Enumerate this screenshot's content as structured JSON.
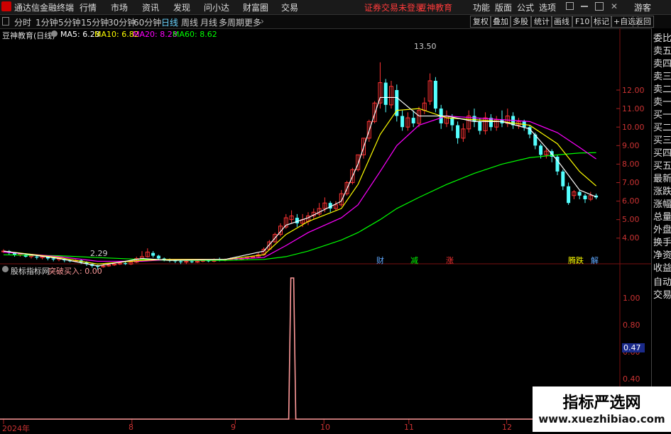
{
  "app": {
    "title": "通达信金融终端"
  },
  "menu": {
    "items": [
      "行情",
      "市场",
      "资讯",
      "发现",
      "问小达",
      "财富圈",
      "交易"
    ],
    "notice": "证券交易未登录",
    "account": "豆神教育",
    "right_items": [
      "功能",
      "版面",
      "公式",
      "选项"
    ],
    "guest": "游客"
  },
  "toolbar": {
    "periods": [
      "分时",
      "1分钟",
      "5分钟",
      "15分钟",
      "30分钟",
      "60分钟",
      "日线",
      "周线",
      "月线",
      "多周期",
      "更多"
    ],
    "selected": "日线",
    "right_buttons": [
      "复权",
      "叠加",
      "多股",
      "统计",
      "画线",
      "F10",
      "标记",
      "+自选",
      "返回"
    ]
  },
  "main_legend": {
    "stock": "豆神教育(日线)",
    "ma": [
      {
        "label": "MA5: 6.23",
        "color": "#ffffff"
      },
      {
        "label": "MA10: 6.82",
        "color": "#ffff00"
      },
      {
        "label": "MA20: 8.28",
        "color": "#ff00ff"
      },
      {
        "label": "MA60: 8.62",
        "color": "#00ff00"
      }
    ]
  },
  "indicator_legend": {
    "name": "股标指标网",
    "value": "突破买入: 0.00"
  },
  "price_axis": [
    "12.00",
    "11.00",
    "10.00",
    "9.00",
    "8.00",
    "7.00",
    "6.00",
    "5.00",
    "4.00"
  ],
  "indicator_axis": [
    "1.00",
    "0.80",
    "0.60",
    "0.40"
  ],
  "indicator_current": "0.47",
  "annotations": {
    "high": "13.50",
    "low": "2.29"
  },
  "event_markers": [
    {
      "label": "财",
      "color": "#5fa8ff"
    },
    {
      "label": "减",
      "color": "#00ff00"
    },
    {
      "label": "涨",
      "color": "#ff3333"
    },
    {
      "label": "腾跌",
      "color": "#ffff00"
    },
    {
      "label": "解",
      "color": "#5fa8ff"
    }
  ],
  "date_axis": [
    "2024年",
    "8",
    "9",
    "10",
    "11",
    "12"
  ],
  "right_panel": [
    "委比",
    "卖五",
    "卖四",
    "卖三",
    "卖二",
    "卖一",
    "买一",
    "买二",
    "买三",
    "买四",
    "买五",
    "最新",
    "涨跌",
    "涨幅",
    "总量",
    "外盘",
    "换手",
    "净资",
    "收益",
    "自动",
    "交易"
  ],
  "watermark": {
    "title": "指标严选网",
    "url": "www.xuezhibiao.com"
  },
  "colors": {
    "up": "#ff3333",
    "down": "#54ffff",
    "ma5": "#ffffff",
    "ma10": "#ffff00",
    "ma20": "#ff00ff",
    "ma60": "#00ff00",
    "signal": "#ff9a9a"
  },
  "chart_data": {
    "type": "candlestick",
    "title": "豆神教育(日线)",
    "ylim": [
      3.0,
      14.0
    ],
    "points": [
      {
        "d": 0,
        "o": 3.3,
        "c": 3.3,
        "h": 3.4,
        "l": 3.2
      },
      {
        "d": 3,
        "o": 3.3,
        "c": 3.2,
        "h": 3.35,
        "l": 3.1
      },
      {
        "d": 6,
        "o": 3.2,
        "c": 3.1,
        "h": 3.25,
        "l": 3.0
      },
      {
        "d": 9,
        "o": 3.1,
        "c": 3.15,
        "h": 3.2,
        "l": 3.0
      },
      {
        "d": 12,
        "o": 3.1,
        "c": 3.0,
        "h": 3.15,
        "l": 2.95
      },
      {
        "d": 15,
        "o": 3.0,
        "c": 3.05,
        "h": 3.1,
        "l": 2.9
      },
      {
        "d": 18,
        "o": 3.0,
        "c": 2.95,
        "h": 3.05,
        "l": 2.85
      },
      {
        "d": 21,
        "o": 2.95,
        "c": 3.0,
        "h": 3.05,
        "l": 2.85
      },
      {
        "d": 24,
        "o": 3.0,
        "c": 2.9,
        "h": 3.05,
        "l": 2.8
      },
      {
        "d": 27,
        "o": 2.9,
        "c": 2.85,
        "h": 2.95,
        "l": 2.75
      },
      {
        "d": 30,
        "o": 2.85,
        "c": 2.9,
        "h": 2.95,
        "l": 2.75
      },
      {
        "d": 33,
        "o": 2.85,
        "c": 2.8,
        "h": 2.9,
        "l": 2.7
      },
      {
        "d": 36,
        "o": 2.8,
        "c": 2.75,
        "h": 2.85,
        "l": 2.7
      },
      {
        "d": 39,
        "o": 2.75,
        "c": 2.8,
        "h": 2.85,
        "l": 2.7
      },
      {
        "d": 42,
        "o": 2.8,
        "c": 2.7,
        "h": 2.85,
        "l": 2.6
      },
      {
        "d": 45,
        "o": 2.7,
        "c": 2.6,
        "h": 2.75,
        "l": 2.5
      },
      {
        "d": 48,
        "o": 2.6,
        "c": 2.5,
        "h": 2.65,
        "l": 2.4
      },
      {
        "d": 51,
        "o": 2.5,
        "c": 2.45,
        "h": 2.55,
        "l": 2.29
      },
      {
        "d": 54,
        "o": 2.45,
        "c": 2.5,
        "h": 2.6,
        "l": 2.4
      },
      {
        "d": 57,
        "o": 2.5,
        "c": 2.55,
        "h": 2.6,
        "l": 2.45
      },
      {
        "d": 60,
        "o": 2.55,
        "c": 2.6,
        "h": 2.65,
        "l": 2.5
      },
      {
        "d": 63,
        "o": 2.6,
        "c": 2.65,
        "h": 2.7,
        "l": 2.55
      },
      {
        "d": 66,
        "o": 2.65,
        "c": 2.6,
        "h": 2.75,
        "l": 2.55
      },
      {
        "d": 69,
        "o": 2.6,
        "c": 2.7,
        "h": 2.8,
        "l": 2.55
      },
      {
        "d": 72,
        "o": 2.7,
        "c": 2.9,
        "h": 3.0,
        "l": 2.65
      },
      {
        "d": 75,
        "o": 2.9,
        "c": 3.0,
        "h": 3.3,
        "l": 2.85
      },
      {
        "d": 78,
        "o": 3.0,
        "c": 3.25,
        "h": 3.45,
        "l": 2.95
      },
      {
        "d": 81,
        "o": 3.2,
        "c": 3.05,
        "h": 3.3,
        "l": 2.95
      },
      {
        "d": 84,
        "o": 3.05,
        "c": 2.9,
        "h": 3.1,
        "l": 2.8
      },
      {
        "d": 87,
        "o": 2.9,
        "c": 2.85,
        "h": 2.95,
        "l": 2.75
      },
      {
        "d": 90,
        "o": 2.85,
        "c": 2.8,
        "h": 2.9,
        "l": 2.7
      },
      {
        "d": 93,
        "o": 2.8,
        "c": 2.75,
        "h": 2.85,
        "l": 2.65
      },
      {
        "d": 96,
        "o": 2.75,
        "c": 2.7,
        "h": 2.8,
        "l": 2.6
      },
      {
        "d": 99,
        "o": 2.7,
        "c": 2.75,
        "h": 2.8,
        "l": 2.6
      },
      {
        "d": 102,
        "o": 2.75,
        "c": 2.7,
        "h": 2.8,
        "l": 2.65
      },
      {
        "d": 105,
        "o": 2.7,
        "c": 2.75,
        "h": 2.85,
        "l": 2.65
      },
      {
        "d": 108,
        "o": 2.75,
        "c": 2.8,
        "h": 2.85,
        "l": 2.7
      },
      {
        "d": 111,
        "o": 2.8,
        "c": 2.75,
        "h": 2.85,
        "l": 2.7
      },
      {
        "d": 114,
        "o": 2.75,
        "c": 2.85,
        "h": 2.9,
        "l": 2.7
      },
      {
        "d": 117,
        "o": 2.85,
        "c": 2.8,
        "h": 2.95,
        "l": 2.75
      },
      {
        "d": 120,
        "o": 2.8,
        "c": 2.85,
        "h": 2.9,
        "l": 2.75
      },
      {
        "d": 123,
        "o": 2.85,
        "c": 2.9,
        "h": 2.95,
        "l": 2.8
      },
      {
        "d": 126,
        "o": 2.9,
        "c": 2.85,
        "h": 2.95,
        "l": 2.8
      },
      {
        "d": 129,
        "o": 2.85,
        "c": 2.9,
        "h": 2.95,
        "l": 2.8
      },
      {
        "d": 132,
        "o": 2.9,
        "c": 2.95,
        "h": 3.0,
        "l": 2.85
      },
      {
        "d": 135,
        "o": 2.95,
        "c": 3.0,
        "h": 3.05,
        "l": 2.9
      },
      {
        "d": 138,
        "o": 3.0,
        "c": 3.1,
        "h": 3.2,
        "l": 2.95
      },
      {
        "d": 141,
        "o": 3.1,
        "c": 3.4,
        "h": 3.5,
        "l": 3.05
      },
      {
        "d": 144,
        "o": 3.4,
        "c": 3.8,
        "h": 3.9,
        "l": 3.35
      },
      {
        "d": 147,
        "o": 3.8,
        "c": 4.2,
        "h": 4.3,
        "l": 3.75
      },
      {
        "d": 150,
        "o": 4.2,
        "c": 4.65,
        "h": 4.8,
        "l": 4.1
      },
      {
        "d": 153,
        "o": 4.6,
        "c": 5.1,
        "h": 5.3,
        "l": 4.5
      },
      {
        "d": 156,
        "o": 5.0,
        "c": 5.2,
        "h": 5.5,
        "l": 4.8
      },
      {
        "d": 159,
        "o": 5.1,
        "c": 4.8,
        "h": 5.3,
        "l": 4.6
      },
      {
        "d": 162,
        "o": 4.8,
        "c": 5.0,
        "h": 5.3,
        "l": 4.6
      },
      {
        "d": 165,
        "o": 4.9,
        "c": 5.2,
        "h": 5.4,
        "l": 4.7
      },
      {
        "d": 168,
        "o": 5.2,
        "c": 5.4,
        "h": 5.6,
        "l": 5.0
      },
      {
        "d": 171,
        "o": 5.3,
        "c": 5.6,
        "h": 5.9,
        "l": 5.2
      },
      {
        "d": 174,
        "o": 5.6,
        "c": 5.9,
        "h": 6.2,
        "l": 5.4
      },
      {
        "d": 177,
        "o": 5.9,
        "c": 5.6,
        "h": 6.0,
        "l": 5.4
      },
      {
        "d": 180,
        "o": 5.6,
        "c": 5.8,
        "h": 6.0,
        "l": 5.5
      },
      {
        "d": 183,
        "o": 5.8,
        "c": 6.4,
        "h": 6.6,
        "l": 5.7
      },
      {
        "d": 186,
        "o": 6.4,
        "c": 7.0,
        "h": 7.1,
        "l": 6.3
      },
      {
        "d": 189,
        "o": 7.0,
        "c": 7.7,
        "h": 7.8,
        "l": 6.9
      },
      {
        "d": 192,
        "o": 7.7,
        "c": 8.5,
        "h": 8.5,
        "l": 7.6
      },
      {
        "d": 195,
        "o": 8.5,
        "c": 9.4,
        "h": 9.4,
        "l": 8.3
      },
      {
        "d": 198,
        "o": 9.4,
        "c": 10.3,
        "h": 10.4,
        "l": 9.2
      },
      {
        "d": 201,
        "o": 10.3,
        "c": 11.3,
        "h": 11.4,
        "l": 10.2
      },
      {
        "d": 204,
        "o": 11.3,
        "c": 12.4,
        "h": 13.5,
        "l": 11.0
      },
      {
        "d": 207,
        "o": 12.4,
        "c": 11.2,
        "h": 12.6,
        "l": 10.8
      },
      {
        "d": 210,
        "o": 11.2,
        "c": 12.2,
        "h": 12.5,
        "l": 11.0
      },
      {
        "d": 213,
        "o": 12.0,
        "c": 10.6,
        "h": 12.3,
        "l": 10.3
      },
      {
        "d": 216,
        "o": 10.6,
        "c": 10.0,
        "h": 10.9,
        "l": 9.8
      },
      {
        "d": 219,
        "o": 10.0,
        "c": 10.5,
        "h": 10.8,
        "l": 9.8
      },
      {
        "d": 222,
        "o": 10.5,
        "c": 10.2,
        "h": 10.9,
        "l": 10.0
      },
      {
        "d": 225,
        "o": 10.2,
        "c": 10.9,
        "h": 11.1,
        "l": 10.0
      },
      {
        "d": 228,
        "o": 10.9,
        "c": 11.3,
        "h": 11.6,
        "l": 10.7
      },
      {
        "d": 231,
        "o": 11.4,
        "c": 12.5,
        "h": 12.9,
        "l": 11.2
      },
      {
        "d": 234,
        "o": 12.5,
        "c": 11.0,
        "h": 12.7,
        "l": 10.8
      },
      {
        "d": 237,
        "o": 11.0,
        "c": 10.2,
        "h": 11.2,
        "l": 9.9
      },
      {
        "d": 240,
        "o": 10.2,
        "c": 10.6,
        "h": 10.9,
        "l": 10.0
      },
      {
        "d": 243,
        "o": 10.5,
        "c": 10.1,
        "h": 10.7,
        "l": 9.8
      },
      {
        "d": 246,
        "o": 10.1,
        "c": 9.4,
        "h": 10.3,
        "l": 9.1
      },
      {
        "d": 249,
        "o": 9.4,
        "c": 9.9,
        "h": 10.2,
        "l": 9.2
      },
      {
        "d": 252,
        "o": 9.9,
        "c": 10.6,
        "h": 10.9,
        "l": 9.7
      },
      {
        "d": 255,
        "o": 10.6,
        "c": 10.3,
        "h": 11.0,
        "l": 10.0
      },
      {
        "d": 258,
        "o": 10.3,
        "c": 9.8,
        "h": 10.5,
        "l": 9.6
      },
      {
        "d": 261,
        "o": 9.8,
        "c": 10.5,
        "h": 10.8,
        "l": 9.6
      },
      {
        "d": 264,
        "o": 10.5,
        "c": 10.0,
        "h": 10.7,
        "l": 9.8
      },
      {
        "d": 267,
        "o": 10.0,
        "c": 10.4,
        "h": 10.6,
        "l": 9.8
      },
      {
        "d": 270,
        "o": 10.4,
        "c": 10.2,
        "h": 10.9,
        "l": 10.0
      },
      {
        "d": 273,
        "o": 10.2,
        "c": 10.6,
        "h": 11.0,
        "l": 10.0
      },
      {
        "d": 276,
        "o": 10.6,
        "c": 10.1,
        "h": 10.8,
        "l": 9.9
      },
      {
        "d": 279,
        "o": 10.1,
        "c": 10.3,
        "h": 10.5,
        "l": 9.9
      },
      {
        "d": 282,
        "o": 10.3,
        "c": 10.0,
        "h": 10.4,
        "l": 9.8
      },
      {
        "d": 285,
        "o": 10.0,
        "c": 9.6,
        "h": 10.1,
        "l": 9.4
      },
      {
        "d": 288,
        "o": 9.6,
        "c": 9.0,
        "h": 9.7,
        "l": 8.8
      },
      {
        "d": 291,
        "o": 9.0,
        "c": 8.5,
        "h": 9.1,
        "l": 8.3
      },
      {
        "d": 294,
        "o": 8.5,
        "c": 8.7,
        "h": 8.9,
        "l": 8.3
      },
      {
        "d": 297,
        "o": 8.7,
        "c": 8.4,
        "h": 8.8,
        "l": 8.1
      },
      {
        "d": 300,
        "o": 8.4,
        "c": 7.6,
        "h": 8.5,
        "l": 7.4
      },
      {
        "d": 303,
        "o": 7.6,
        "c": 6.8,
        "h": 7.7,
        "l": 6.6
      },
      {
        "d": 306,
        "o": 6.8,
        "c": 5.9,
        "h": 7.0,
        "l": 5.8
      },
      {
        "d": 309,
        "o": 6.3,
        "c": 6.5,
        "h": 6.6,
        "l": 6.1
      },
      {
        "d": 312,
        "o": 6.5,
        "c": 6.3,
        "h": 6.6,
        "l": 6.1
      },
      {
        "d": 315,
        "o": 6.3,
        "c": 6.1,
        "h": 6.4,
        "l": 5.9
      },
      {
        "d": 318,
        "o": 6.1,
        "c": 6.3,
        "h": 6.5,
        "l": 6.0
      },
      {
        "d": 321,
        "o": 6.3,
        "c": 6.2,
        "h": 6.4,
        "l": 6.1
      }
    ],
    "ma5": [
      [
        0,
        3.3
      ],
      [
        30,
        2.9
      ],
      [
        51,
        2.5
      ],
      [
        75,
        2.9
      ],
      [
        90,
        2.8
      ],
      [
        120,
        2.85
      ],
      [
        141,
        3.3
      ],
      [
        153,
        4.7
      ],
      [
        165,
        5.1
      ],
      [
        183,
        6.0
      ],
      [
        192,
        8.0
      ],
      [
        204,
        11.6
      ],
      [
        213,
        11.6
      ],
      [
        225,
        10.6
      ],
      [
        240,
        10.6
      ],
      [
        255,
        10.3
      ],
      [
        270,
        10.3
      ],
      [
        285,
        9.9
      ],
      [
        300,
        8.2
      ],
      [
        312,
        6.6
      ],
      [
        321,
        6.23
      ]
    ],
    "ma10": [
      [
        0,
        3.3
      ],
      [
        30,
        2.95
      ],
      [
        51,
        2.6
      ],
      [
        75,
        2.8
      ],
      [
        90,
        2.85
      ],
      [
        120,
        2.85
      ],
      [
        141,
        3.1
      ],
      [
        153,
        4.2
      ],
      [
        165,
        4.9
      ],
      [
        183,
        5.6
      ],
      [
        192,
        6.9
      ],
      [
        204,
        9.6
      ],
      [
        213,
        10.9
      ],
      [
        225,
        11.0
      ],
      [
        240,
        10.5
      ],
      [
        255,
        10.4
      ],
      [
        270,
        10.3
      ],
      [
        285,
        10.1
      ],
      [
        300,
        9.1
      ],
      [
        312,
        7.6
      ],
      [
        321,
        6.82
      ]
    ],
    "ma20": [
      [
        0,
        3.25
      ],
      [
        30,
        3.0
      ],
      [
        51,
        2.75
      ],
      [
        75,
        2.75
      ],
      [
        90,
        2.85
      ],
      [
        120,
        2.85
      ],
      [
        141,
        2.95
      ],
      [
        153,
        3.6
      ],
      [
        165,
        4.3
      ],
      [
        183,
        5.1
      ],
      [
        192,
        5.8
      ],
      [
        204,
        7.6
      ],
      [
        213,
        9.0
      ],
      [
        225,
        10.1
      ],
      [
        240,
        10.6
      ],
      [
        255,
        10.5
      ],
      [
        270,
        10.4
      ],
      [
        285,
        10.3
      ],
      [
        300,
        9.7
      ],
      [
        312,
        8.9
      ],
      [
        321,
        8.28
      ]
    ],
    "ma60": [
      [
        0,
        3.1
      ],
      [
        30,
        3.05
      ],
      [
        51,
        2.95
      ],
      [
        75,
        2.85
      ],
      [
        90,
        2.8
      ],
      [
        120,
        2.8
      ],
      [
        141,
        2.85
      ],
      [
        153,
        3.0
      ],
      [
        165,
        3.3
      ],
      [
        183,
        3.9
      ],
      [
        192,
        4.3
      ],
      [
        204,
        5.0
      ],
      [
        213,
        5.6
      ],
      [
        225,
        6.2
      ],
      [
        240,
        6.9
      ],
      [
        255,
        7.5
      ],
      [
        270,
        8.0
      ],
      [
        285,
        8.35
      ],
      [
        300,
        8.5
      ],
      [
        312,
        8.6
      ],
      [
        321,
        8.62
      ]
    ],
    "signal": {
      "peak_day": 156,
      "peak_value": 1.0,
      "current": 0.47
    }
  }
}
